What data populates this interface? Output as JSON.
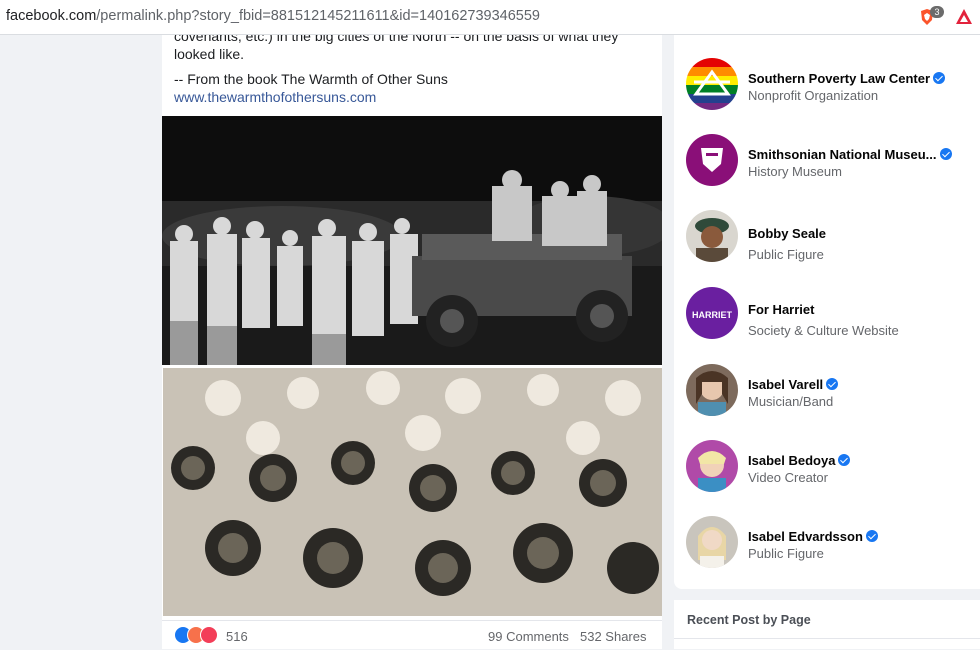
{
  "browser": {
    "url_host": "facebook.com",
    "url_path": "/permalink.php?story_fbid=881512145211611&id=140162739346559",
    "extension_badge": "3"
  },
  "post": {
    "text_line1": "covenants, etc.) in the big cities of the North -- on the basis of what they",
    "text_line2": "looked like.",
    "text_line3": "-- From the book The Warmth of Other Suns",
    "link": "www.thewarmthofothersuns.com",
    "reaction_count": "516",
    "comments": "99 Comments",
    "shares": "532 Shares"
  },
  "pages": [
    {
      "name": "Southern Poverty Law Center",
      "category": "Nonprofit Organization",
      "verified": true
    },
    {
      "name": "Smithsonian National Museu...",
      "category": "History Museum",
      "verified": true
    },
    {
      "name": "Bobby Seale",
      "category": "Public Figure",
      "verified": false
    },
    {
      "name": "For Harriet",
      "category": "Society & Culture Website",
      "verified": false,
      "avatar_text": "HARRIET"
    },
    {
      "name": "Isabel Varell",
      "category": "Musician/Band",
      "verified": true
    },
    {
      "name": "Isabel Bedoya",
      "category": "Video Creator",
      "verified": true
    },
    {
      "name": "Isabel Edvardsson",
      "category": "Public Figure",
      "verified": true
    }
  ],
  "recent_section": {
    "title": "Recent Post by Page"
  },
  "colors": {
    "link": "#385898",
    "verified": "#1877f2",
    "secondary_text": "#65676b",
    "page_bg": "#f0f2f5"
  }
}
